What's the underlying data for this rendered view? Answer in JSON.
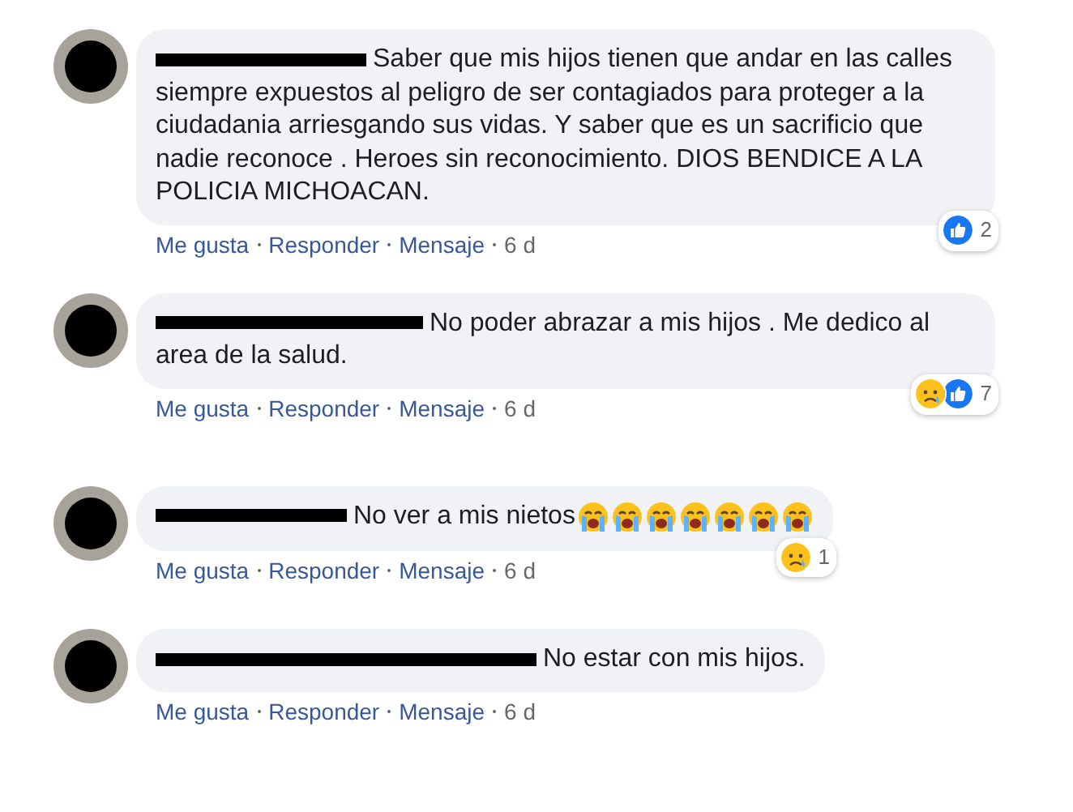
{
  "comments": [
    {
      "text": "Saber que mis hijos tienen que andar en las calles siempre expuestos al peligro de ser contagiados para proteger a la ciudadania arriesgando sus vidas. Y saber que es un sacrificio que nadie reconoce . Heroes sin reconocimiento. DIOS BENDICE A LA POLICIA MICHOACAN.",
      "reactions": [
        {
          "kind": "like"
        }
      ],
      "reaction_count": "2",
      "actions": [
        "Me gusta",
        "Responder",
        "Mensaje"
      ],
      "time": "6 d"
    },
    {
      "text": "No poder abrazar a mis hijos . Me dedico al area de la salud.",
      "reactions": [
        {
          "kind": "sad"
        },
        {
          "kind": "like"
        }
      ],
      "reaction_count": "7",
      "actions": [
        "Me gusta",
        "Responder",
        "Mensaje"
      ],
      "time": "6 d"
    },
    {
      "text": "No ver a mis nietos",
      "emojis": [
        {
          "kind": "crying"
        },
        {
          "kind": "crying"
        },
        {
          "kind": "crying"
        },
        {
          "kind": "crying"
        },
        {
          "kind": "crying"
        },
        {
          "kind": "crying"
        },
        {
          "kind": "crying"
        }
      ],
      "reactions": [
        {
          "kind": "sad"
        }
      ],
      "reaction_count": "1",
      "actions": [
        "Me gusta",
        "Responder",
        "Mensaje"
      ],
      "time": "6 d"
    },
    {
      "text": "No estar con mis hijos.",
      "actions": [
        "Me gusta",
        "Responder",
        "Mensaje"
      ],
      "time": "6 d"
    }
  ]
}
